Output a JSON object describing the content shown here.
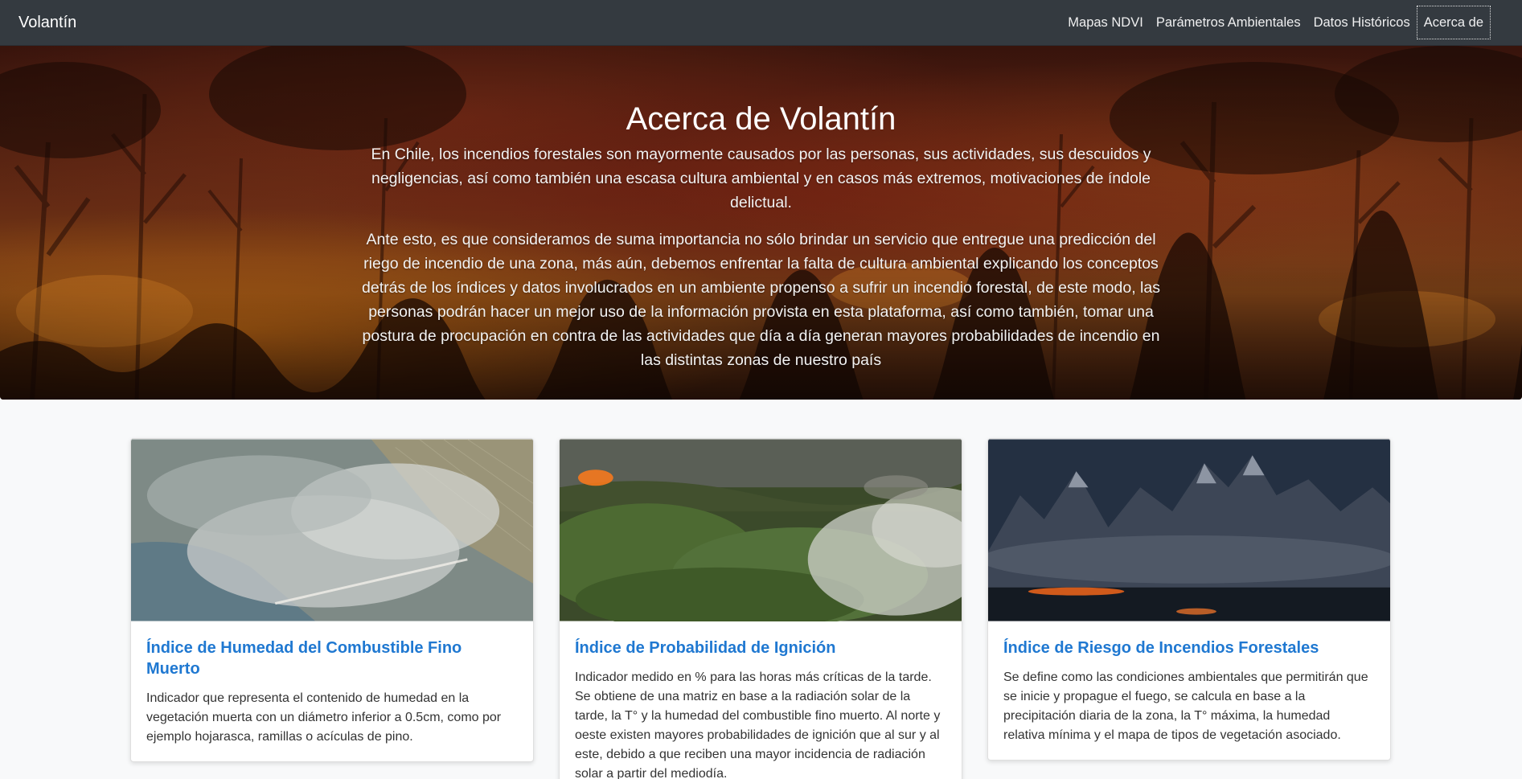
{
  "navbar": {
    "brand": "Volantín",
    "links": [
      "Mapas NDVI",
      "Parámetros Ambientales",
      "Datos Históricos",
      "Acerca de"
    ]
  },
  "hero": {
    "title": "Acerca de Volantín",
    "paragraphs": [
      "En Chile, los incendios forestales son mayormente causados por las personas, sus actividades, sus descuidos y negligencias, así como también una escasa cultura ambiental y en casos más extremos, motivaciones de índole delictual.",
      "Ante esto, es que consideramos de suma importancia no sólo brindar un servicio que entregue una predicción del riego de incendio de una zona, más aún, debemos enfrentar la falta de cultura ambiental explicando los conceptos detrás de los índices y datos involucrados en un ambiente propenso a sufrir un incendio forestal, de este modo, las personas podrán hacer un mejor uso de la información provista en esta plataforma, así como también, tomar una postura de procupación en contra de las actividades que día a día generan mayores probabilidades de incendio en las distintas zonas de nuestro país"
    ]
  },
  "cards": [
    {
      "title": "Índice de Humedad del Combustible Fino Muerto",
      "text": "Indicador que representa el contenido de humedad en la vegetación muerta con un diámetro inferior a 0.5cm, como por ejemplo hojarasca, ramillas o acículas de pino.",
      "image": "aerial-smoke-fields"
    },
    {
      "title": "Índice de Probabilidad de Ignición",
      "text": "Indicador medido en % para las horas más críticas de la tarde. Se obtiene de una matriz en base a la radiación solar de la tarde, la T° y la humedad del combustible fino muerto. Al norte y oeste existen mayores probabilidades de ignición que al sur y al este, debido a que reciben una mayor incidencia de radiación solar a partir del mediodía.",
      "image": "shrubland-fire-smoke"
    },
    {
      "title": "Índice de Riesgo de Incendios Forestales",
      "text": "Se define como las condiciones ambientales que permitirán que se inicie y propague el fuego, se calcula en base a la precipitación diaria de la zona, la T° máxima, la humedad relativa mínima y el mapa de tipos de vegetación asociado.",
      "image": "mountains-night-fire"
    }
  ],
  "colors": {
    "navbar_bg": "#343a40",
    "card_title": "#1f78d1",
    "page_bg": "#f8f9fa"
  }
}
